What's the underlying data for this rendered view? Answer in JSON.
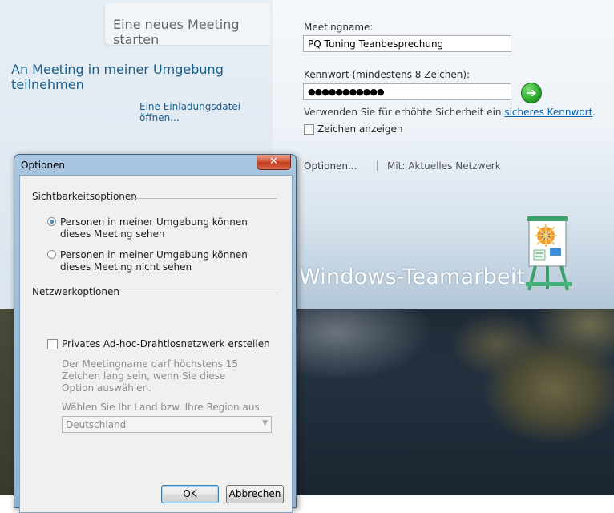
{
  "left_pane": {
    "start_tab": "Eine neues Meeting starten",
    "join_title": "An Meeting in meiner Umgebung teilnehmen",
    "open_invite_link": "Eine Einladungsdatei öffnen..."
  },
  "form": {
    "meeting_name_label": "Meetingname:",
    "meeting_name_value": "PQ Tuning Teanbesprechung",
    "password_label": "Kennwort (mindestens 8 Zeichen):",
    "password_value": "●●●●●●●●●●●",
    "go_button_icon": "go-arrow-icon",
    "security_text": "Verwenden Sie für erhöhte Sicherheit ein ",
    "security_link": "sicheres Kennwort",
    "security_suffix": ".",
    "show_chars_label": "Zeichen anzeigen",
    "show_chars_checked": false,
    "options_link": "Optionen...",
    "separator": "|",
    "network_label": "Mit: Aktuelles Netzwerk"
  },
  "brand": {
    "text": "Windows-Teamarbeit",
    "icon": "flipchart-icon"
  },
  "dialog": {
    "title": "Optionen",
    "close_glyph": "✕",
    "visibility_group": "Sichtbarkeitsoptionen",
    "radio_visible": "Personen in meiner Umgebung können dieses Meeting sehen",
    "radio_visible_checked": true,
    "radio_hidden": "Personen in meiner Umgebung können dieses Meeting nicht sehen",
    "radio_hidden_checked": false,
    "network_group": "Netzwerkoptionen",
    "adhoc_label": "Privates Ad-hoc-Drahtlosnetzwerk erstellen",
    "adhoc_checked": false,
    "adhoc_note": "Der Meetingname darf höchstens 15 Zeichen lang sein, wenn Sie diese Option auswählen.",
    "country_label": "Wählen Sie Ihr Land bzw. Ihre Region aus:",
    "country_value": "Deutschland",
    "ok_label": "OK",
    "cancel_label": "Abbrechen"
  },
  "colors": {
    "link_blue": "#1c5e8c",
    "accent_green": "#2fae2c",
    "close_red": "#c23a1c"
  }
}
